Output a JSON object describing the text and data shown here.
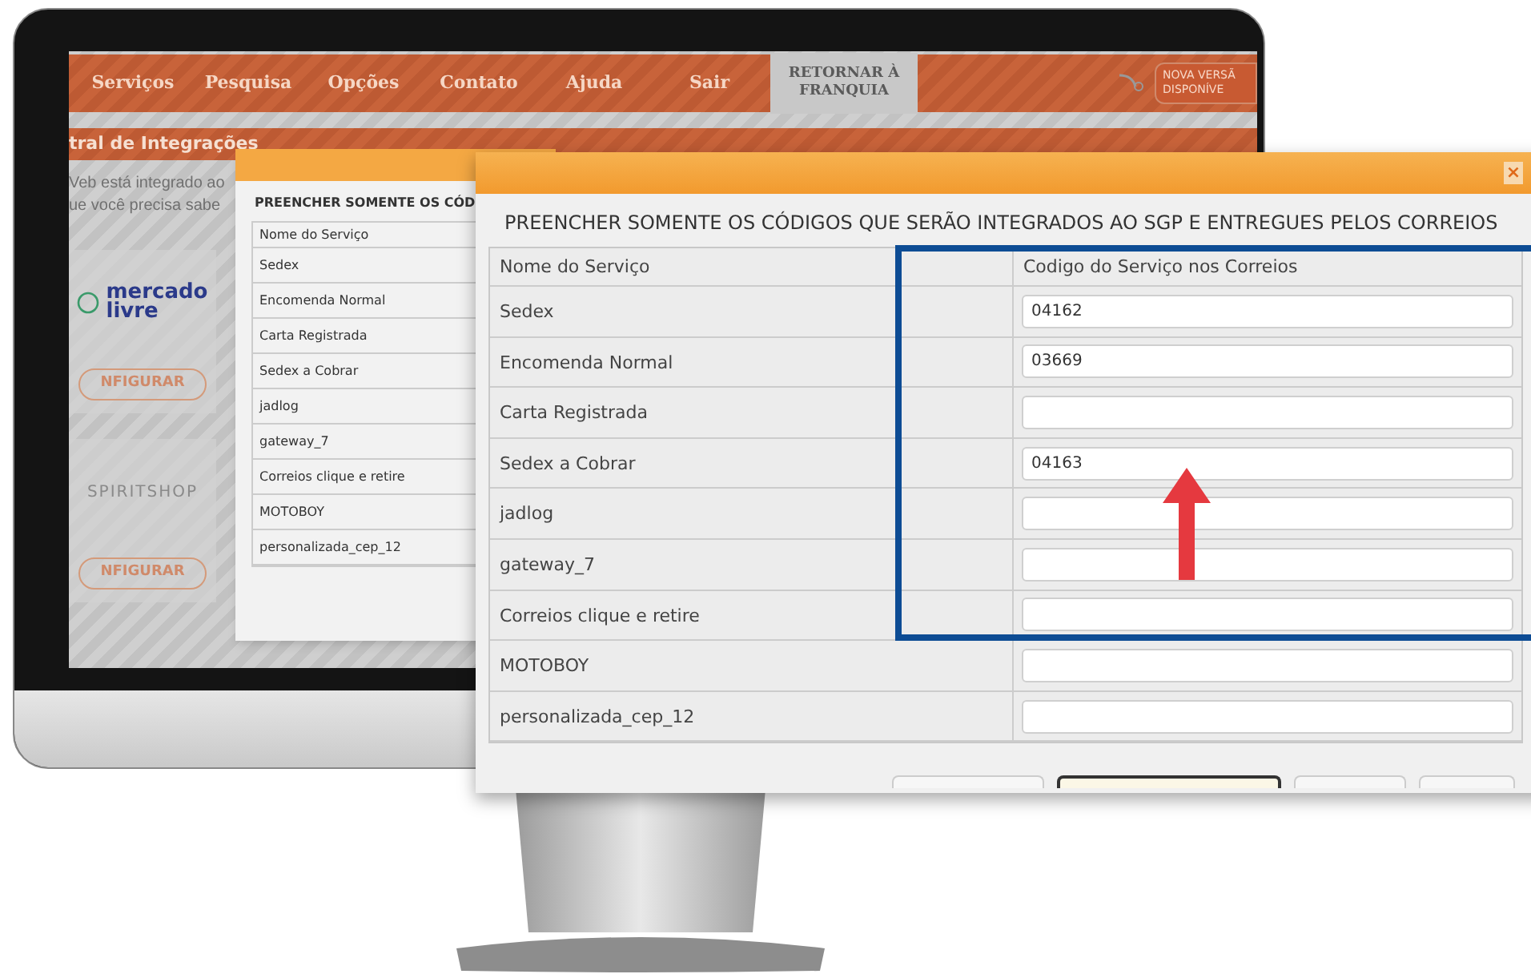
{
  "nav": {
    "items": [
      {
        "label": "Serviços"
      },
      {
        "label": "Pesquisa"
      },
      {
        "label": "Opções"
      },
      {
        "label": "Contato"
      },
      {
        "label": "Ajuda"
      },
      {
        "label": "Sair"
      }
    ],
    "return_button": "RETORNAR À FRANQUIA",
    "update_badge": [
      "NOVA VERSÃ",
      "DISPONÍVE"
    ]
  },
  "breadcrumb": "tral de Integrações",
  "intro_lines": [
    "Veb está integrado ao",
    "ue você precisa sabe"
  ],
  "cards": [
    {
      "kind": "logo",
      "logo_lines": [
        "mercado",
        "livre"
      ],
      "button": "NFIGURAR"
    },
    {
      "kind": "wordmark",
      "logo_lines": [
        "SPIRITSHOP"
      ],
      "button": "NFIGURAR"
    }
  ],
  "back_dialog": {
    "title": "PREENCHER SOMENTE OS CÓD",
    "column": "Nome do Serviço",
    "rows": [
      "Sedex",
      "Encomenda Normal",
      "Carta Registrada",
      "Sedex a Cobrar",
      "jadlog",
      "gateway_7",
      "Correios clique e retire",
      "MOTOBOY",
      "personalizada_cep_12"
    ]
  },
  "dialog": {
    "close": "×",
    "title": "PREENCHER SOMENTE OS CÓDIGOS QUE SERÃO INTEGRADOS AO SGP E ENTREGUES PELOS CORREIOS",
    "columns": [
      "Nome do Serviço",
      "Codigo do Serviço nos Correios"
    ],
    "header_highlighted": true,
    "rows": [
      {
        "name": "Sedex",
        "code": "04162",
        "highlighted": true
      },
      {
        "name": "Encomenda Normal",
        "code": "03669",
        "highlighted": true
      },
      {
        "name": "Carta Registrada",
        "highlighted": true
      },
      {
        "name": "Sedex a Cobrar",
        "code": "04163",
        "highlighted": true
      },
      {
        "name": "jadlog",
        "highlighted": true
      },
      {
        "name": "gateway_7",
        "highlighted": true
      },
      {
        "name": "Correios clique e retire",
        "highlighted": true
      },
      {
        "name": "MOTOBOY",
        "highlighted": false
      },
      {
        "name": "personalizada_cep_12",
        "highlighted": false
      }
    ]
  }
}
